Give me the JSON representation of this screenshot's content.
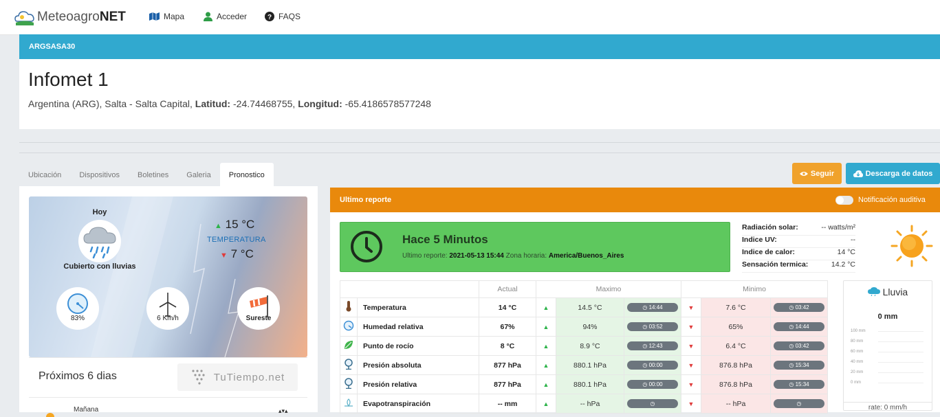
{
  "navbar": {
    "logo_prefix": "Meteoagro",
    "logo_bold": "NET",
    "items": [
      {
        "label": "Mapa"
      },
      {
        "label": "Acceder"
      },
      {
        "label": "FAQS"
      }
    ]
  },
  "station": {
    "code": "ARGSASA30",
    "name": "Infomet 1",
    "location": "Argentina (ARG), Salta - Salta Capital,",
    "lat_label": "Latitud:",
    "lat_value": "-24.74468755,",
    "lon_label": "Longitud:",
    "lon_value": "-65.4186578577248"
  },
  "tabs": [
    "Ubicación",
    "Dispositivos",
    "Boletines",
    "Galeria",
    "Pronostico"
  ],
  "active_tab": "Pronostico",
  "actions": {
    "seguir": "Seguir",
    "descarga": "Descarga de datos"
  },
  "forecast": {
    "day": "Hoy",
    "condition": "Cubierto con lluvias",
    "temp_max": "15 °C",
    "temp_label": "TEMPERATURA",
    "temp_min": "7 °C",
    "humidity": "83%",
    "wind": "6 Km/h",
    "wind_dir": "Sureste",
    "next_days_label": "Próximos 6 dias",
    "provider": "TuTiempo.net",
    "next_day": "Mañana"
  },
  "report": {
    "bar_title": "Ultimo reporte",
    "notif_label": "Notificación auditiva",
    "hace": "Hace 5 Minutos",
    "ultimo_label": "Ultimo reporte:",
    "ultimo_value": "2021-05-13 15:44",
    "zona_label": "Zona horaria:",
    "zona_value": "America/Buenos_Aires",
    "stats": [
      {
        "k": "Radiación solar:",
        "v": "-- watts/m²"
      },
      {
        "k": "Indice UV:",
        "v": "--"
      },
      {
        "k": "Indice de calor:",
        "v": "14 °C"
      },
      {
        "k": "Sensación termica:",
        "v": "14.2 °C"
      }
    ]
  },
  "table": {
    "headers": {
      "actual": "Actual",
      "maximo": "Maximo",
      "minimo": "Minimo"
    },
    "rows": [
      {
        "icon": "thermometer-icon",
        "name": "Temperatura",
        "actual": "14 °C",
        "max": "14.5 °C",
        "max_t": "14:44",
        "min": "7.6 °C",
        "min_t": "03:42"
      },
      {
        "icon": "humidity-icon",
        "name": "Humedad relativa",
        "actual": "67%",
        "max": "94%",
        "max_t": "03:52",
        "min": "65%",
        "min_t": "14:44"
      },
      {
        "icon": "leaf-icon",
        "name": "Punto de rocío",
        "actual": "8 °C",
        "max": "8.9 °C",
        "max_t": "12:43",
        "min": "6.4 °C",
        "min_t": "03:42"
      },
      {
        "icon": "barometer-icon",
        "name": "Presión absoluta",
        "actual": "877 hPa",
        "max": "880.1 hPa",
        "max_t": "00:00",
        "min": "876.8 hPa",
        "min_t": "15:34"
      },
      {
        "icon": "barometer-icon",
        "name": "Presión relativa",
        "actual": "877 hPa",
        "max": "880.1 hPa",
        "max_t": "00:00",
        "min": "876.8 hPa",
        "min_t": "15:34"
      },
      {
        "icon": "evapotranspiration-icon",
        "name": "Evapotranspiración",
        "actual": "-- mm",
        "max": "-- hPa",
        "max_t": "",
        "min": "-- hPa",
        "min_t": ""
      }
    ]
  },
  "rain": {
    "title": "Lluvia",
    "value": "0 mm",
    "scale": [
      "100 mm",
      "80 mm",
      "60 mm",
      "40 mm",
      "20 mm",
      "0 mm"
    ],
    "rate": "rate: 0 mm/h"
  }
}
